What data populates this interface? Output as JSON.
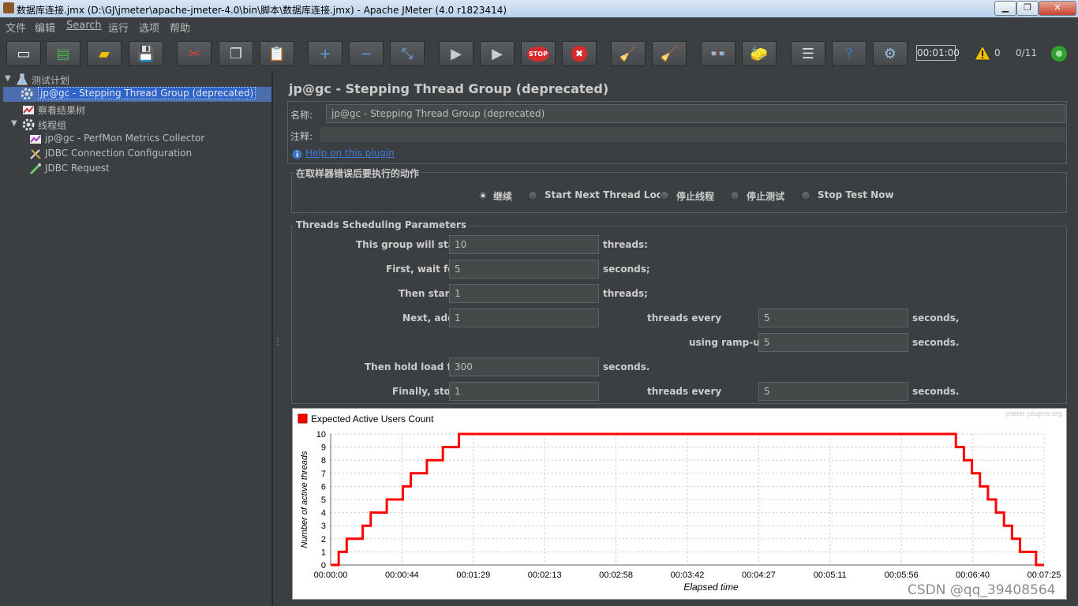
{
  "window": {
    "title": "数据库连接.jmx (D:\\GJ\\jmeter\\apache-jmeter-4.0\\bin\\脚本\\数据库连接.jmx) - Apache JMeter (4.0 r1823414)",
    "minimize_glyph": "▁",
    "maximize_glyph": "❐",
    "close_glyph": "✕"
  },
  "menu": [
    "文件",
    "编辑",
    "Search",
    "运行",
    "选项",
    "帮助"
  ],
  "toolbar": {
    "icons": [
      "new-icon",
      "templates-icon",
      "open-icon",
      "save-icon",
      "cut-icon",
      "copy-icon",
      "paste-icon",
      "expand-icon",
      "collapse-icon",
      "toggle-icon",
      "start-icon",
      "start-no-pause-icon",
      "stop-icon",
      "shutdown-icon",
      "clear-icon",
      "clear-all-icon",
      "search-icon",
      "reset-search-icon",
      "function-helper-icon",
      "help-icon",
      "remote-icon"
    ],
    "glyphs": [
      "▭",
      "▤",
      "▰",
      "💾",
      "✂",
      "❐",
      "📋",
      "+",
      "−",
      "⤡",
      "▶",
      "▶",
      "STOP",
      "✖",
      "🧹",
      "🧹",
      "👓",
      "🧽",
      "☰",
      "?",
      "⚙"
    ],
    "timer": "00:01:00",
    "warnings": "0",
    "threads": "0/11",
    "status_color": "#2ea12e"
  },
  "tree": {
    "items": [
      {
        "label": "测试计划",
        "icon": "test-plan-icon"
      },
      {
        "label": "jp@gc - Stepping Thread Group (deprecated)",
        "icon": "gear-icon",
        "selected": true
      },
      {
        "label": "察看结果树",
        "icon": "listener-icon"
      },
      {
        "label": "线程组",
        "icon": "gear-icon"
      },
      {
        "label": "jp@gc - PerfMon Metrics Collector",
        "icon": "listener-icon"
      },
      {
        "label": "JDBC Connection Configuration",
        "icon": "config-icon"
      },
      {
        "label": "JDBC Request",
        "icon": "sampler-icon"
      }
    ]
  },
  "panel": {
    "title": "jp@gc - Stepping Thread Group (deprecated)",
    "name_label": "名称:",
    "name_value": "jp@gc - Stepping Thread Group (deprecated)",
    "comment_label": "注释:",
    "comment_value": "",
    "help_link": "Help on this plugin",
    "error_action": {
      "title": "在取样器错误后要执行的动作",
      "options": [
        {
          "label": "继续",
          "checked": true
        },
        {
          "label": "Start Next Thread Loop",
          "checked": false
        },
        {
          "label": "停止线程",
          "checked": false
        },
        {
          "label": "停止测试",
          "checked": false
        },
        {
          "label": "Stop Test Now",
          "checked": false
        }
      ]
    },
    "schedule": {
      "title": "Threads Scheduling Parameters",
      "start_label": "This group will start",
      "start_value": "10",
      "start_unit": "threads:",
      "wait_label": "First, wait for",
      "wait_value": "5",
      "wait_unit": "seconds;",
      "then_label": "Then start",
      "then_value": "1",
      "then_unit": "threads;",
      "add_label": "Next, add",
      "add_value": "1",
      "add_every_label": "threads every",
      "add_every_value": "5",
      "add_every_unit": "seconds,",
      "rampup_label": "using ramp-up",
      "rampup_value": "5",
      "rampup_unit": "seconds.",
      "hold_label": "Then hold load for",
      "hold_value": "300",
      "hold_unit": "seconds.",
      "stop_label": "Finally, stop",
      "stop_value": "1",
      "stop_every_label": "threads every",
      "stop_every_value": "5",
      "stop_every_unit": "seconds."
    }
  },
  "chart_data": {
    "type": "line",
    "legend": "Expected Active Users Count",
    "legend_color": "#ff0000",
    "branding": "jmeter-plugins.org",
    "xlabel": "Elapsed time",
    "ylabel": "Number of active threads",
    "ylim": [
      0,
      10
    ],
    "xlim": [
      0,
      445
    ],
    "grid": true,
    "xticks": [
      "00:00:00",
      "00:00:44",
      "00:01:29",
      "00:02:13",
      "00:02:58",
      "00:03:42",
      "00:04:27",
      "00:05:11",
      "00:05:56",
      "00:06:40",
      "00:07:25"
    ],
    "yticks": [
      "0",
      "1",
      "2",
      "3",
      "4",
      "5",
      "6",
      "7",
      "8",
      "9",
      "10"
    ],
    "series": [
      {
        "name": "Expected Active Users Count",
        "x": [
          0,
          5,
          5,
          10,
          10,
          15,
          15,
          20,
          20,
          25,
          25,
          30,
          30,
          35,
          35,
          40,
          40,
          45,
          45,
          50,
          50,
          55,
          55,
          60,
          60,
          65,
          65,
          70,
          70,
          75,
          75,
          80,
          80,
          85,
          85,
          90,
          90,
          95,
          95,
          390,
          390,
          395,
          395,
          400,
          400,
          405,
          405,
          410,
          410,
          415,
          415,
          420,
          420,
          425,
          425,
          430,
          430,
          435,
          435,
          440,
          440,
          445
        ],
        "y": [
          0,
          0,
          1,
          1,
          2,
          2,
          2,
          2,
          3,
          3,
          4,
          4,
          4,
          4,
          5,
          5,
          5,
          5,
          6,
          6,
          7,
          7,
          7,
          7,
          8,
          8,
          8,
          8,
          9,
          9,
          9,
          9,
          10,
          10,
          10,
          10,
          10,
          10,
          10,
          10,
          9,
          9,
          8,
          8,
          7,
          7,
          6,
          6,
          5,
          5,
          4,
          4,
          3,
          3,
          2,
          2,
          1,
          1,
          1,
          1,
          0,
          0
        ]
      }
    ]
  },
  "watermark": "CSDN @qq_39408564"
}
